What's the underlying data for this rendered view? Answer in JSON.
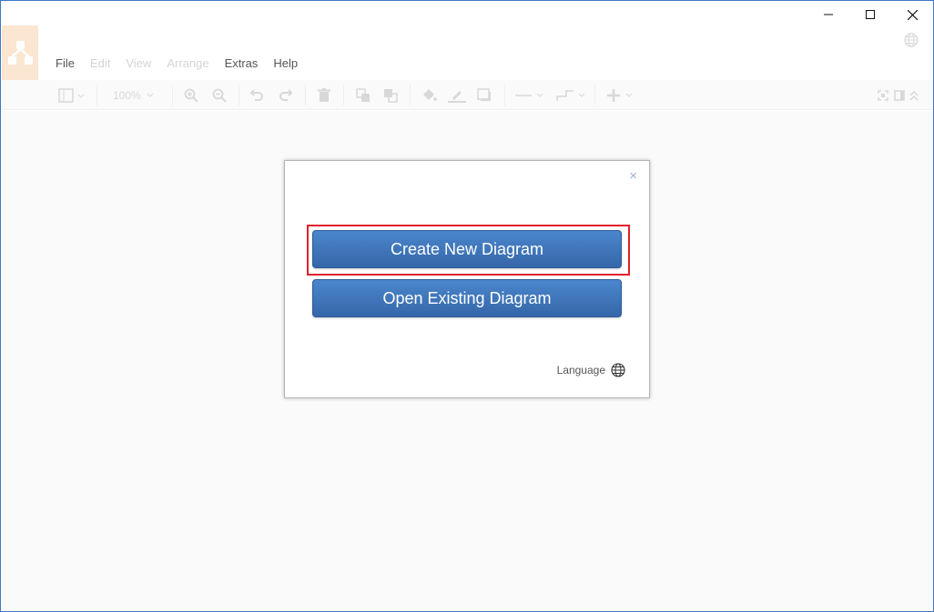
{
  "window": {
    "controls": [
      "minimize",
      "maximize",
      "close"
    ]
  },
  "menubar": {
    "items": [
      {
        "label": "File",
        "enabled": true
      },
      {
        "label": "Edit",
        "enabled": false
      },
      {
        "label": "View",
        "enabled": false
      },
      {
        "label": "Arrange",
        "enabled": false
      },
      {
        "label": "Extras",
        "enabled": true
      },
      {
        "label": "Help",
        "enabled": true
      }
    ]
  },
  "toolbar": {
    "zoom": "100%"
  },
  "dialog": {
    "close_glyph": "×",
    "create_label": "Create New Diagram",
    "open_label": "Open Existing Diagram",
    "language_label": "Language"
  },
  "colors": {
    "accent": "#3c78c4",
    "button": "#3f75bb",
    "highlight": "#e0212a",
    "logo_bg": "#fbe6d2"
  }
}
